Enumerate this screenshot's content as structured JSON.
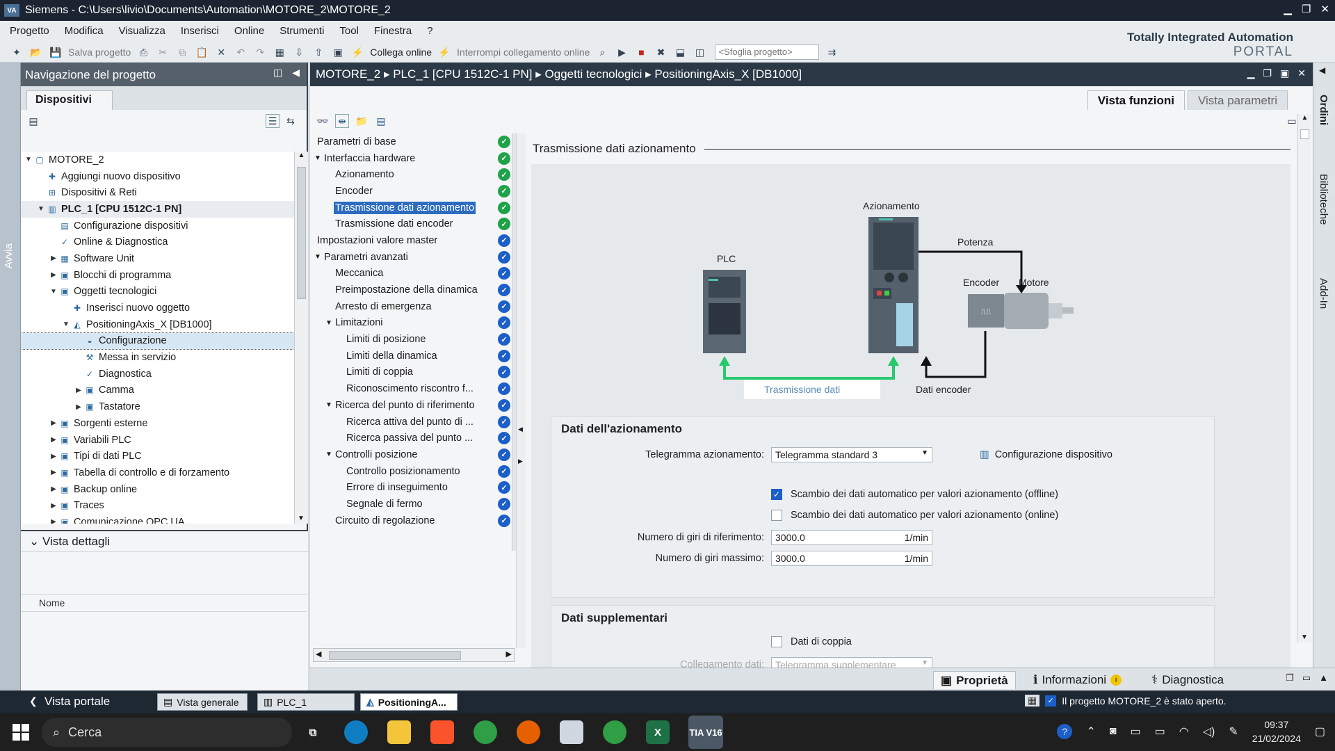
{
  "window": {
    "title": "Siemens - C:\\Users\\livio\\Documents\\Automation\\MOTORE_2\\MOTORE_2",
    "logo": "VA"
  },
  "menu": [
    "Progetto",
    "Modifica",
    "Visualizza",
    "Inserisci",
    "Online",
    "Strumenti",
    "Tool",
    "Finestra",
    "?"
  ],
  "toolbar": {
    "save": "Salva progetto",
    "connect": "Collega online",
    "disconnect": "Interrompi collegamento online",
    "browse_placeholder": "<Sfoglia progetto>"
  },
  "tia": {
    "line1": "Totally Integrated Automation",
    "line2": "PORTAL"
  },
  "side_left": "Avvia",
  "nav": {
    "title": "Navigazione del progetto",
    "tab": "Dispositivi",
    "tree": [
      {
        "label": "MOTORE_2",
        "level": 0,
        "tri": "▼",
        "icon": "project-icon"
      },
      {
        "label": "Aggiungi nuovo dispositivo",
        "level": 1,
        "tri": "",
        "icon": "add-device-icon"
      },
      {
        "label": "Dispositivi & Reti",
        "level": 1,
        "tri": "",
        "icon": "network-icon"
      },
      {
        "label": "PLC_1 [CPU 1512C-1 PN]",
        "level": 1,
        "tri": "▼",
        "icon": "plc-icon",
        "hl": true
      },
      {
        "label": "Configurazione dispositivi",
        "level": 2,
        "tri": "",
        "icon": "config-icon"
      },
      {
        "label": "Online & Diagnostica",
        "level": 2,
        "tri": "",
        "icon": "diagnostics-icon"
      },
      {
        "label": "Software Unit",
        "level": 2,
        "tri": "▶",
        "icon": "software-unit-icon"
      },
      {
        "label": "Blocchi di programma",
        "level": 2,
        "tri": "▶",
        "icon": "folder-icon"
      },
      {
        "label": "Oggetti tecnologici",
        "level": 2,
        "tri": "▼",
        "icon": "folder-icon"
      },
      {
        "label": "Inserisci nuovo oggetto",
        "level": 3,
        "tri": "",
        "icon": "add-object-icon"
      },
      {
        "label": "PositioningAxis_X [DB1000]",
        "level": 3,
        "tri": "▼",
        "icon": "axis-icon"
      },
      {
        "label": "Configurazione",
        "level": 4,
        "tri": "",
        "icon": "configuration-icon",
        "sel": true
      },
      {
        "label": "Messa in servizio",
        "level": 4,
        "tri": "",
        "icon": "commissioning-icon"
      },
      {
        "label": "Diagnostica",
        "level": 4,
        "tri": "",
        "icon": "diagnostics-icon"
      },
      {
        "label": "Camma",
        "level": 4,
        "tri": "▶",
        "icon": "folder-icon"
      },
      {
        "label": "Tastatore",
        "level": 4,
        "tri": "▶",
        "icon": "folder-icon"
      },
      {
        "label": "Sorgenti esterne",
        "level": 2,
        "tri": "▶",
        "icon": "folder-icon"
      },
      {
        "label": "Variabili PLC",
        "level": 2,
        "tri": "▶",
        "icon": "folder-icon"
      },
      {
        "label": "Tipi di dati PLC",
        "level": 2,
        "tri": "▶",
        "icon": "folder-icon"
      },
      {
        "label": "Tabella di controllo e di forzamento",
        "level": 2,
        "tri": "▶",
        "icon": "folder-icon"
      },
      {
        "label": "Backup online",
        "level": 2,
        "tri": "▶",
        "icon": "folder-icon"
      },
      {
        "label": "Traces",
        "level": 2,
        "tri": "▶",
        "icon": "folder-icon"
      },
      {
        "label": "Comunicazione OPC UA",
        "level": 2,
        "tri": "▶",
        "icon": "folder-icon"
      }
    ]
  },
  "details": {
    "title": "Vista dettagli",
    "col": "Nome"
  },
  "breadcrumb": {
    "parts": [
      "MOTORE_2",
      "PLC_1 [CPU 1512C-1 PN]",
      "Oggetti tecnologici",
      "PositioningAxis_X [DB1000]"
    ]
  },
  "viewtabs": {
    "func": "Vista funzioni",
    "param": "Vista parametri"
  },
  "config": [
    {
      "label": "Parametri di base",
      "level": 0,
      "tri": "",
      "status": "ok"
    },
    {
      "label": "Interfaccia hardware",
      "level": 0,
      "tri": "▼",
      "status": "ok"
    },
    {
      "label": "Azionamento",
      "level": 1,
      "tri": "",
      "status": "ok"
    },
    {
      "label": "Encoder",
      "level": 1,
      "tri": "",
      "status": "ok"
    },
    {
      "label": "Trasmissione dati azionamento",
      "level": 1,
      "tri": "",
      "status": "ok",
      "sel": true
    },
    {
      "label": "Trasmissione dati encoder",
      "level": 1,
      "tri": "",
      "status": "ok"
    },
    {
      "label": "Impostazioni valore master",
      "level": 0,
      "tri": "",
      "status": "bl"
    },
    {
      "label": "Parametri avanzati",
      "level": 0,
      "tri": "▼",
      "status": "bl"
    },
    {
      "label": "Meccanica",
      "level": 1,
      "tri": "",
      "status": "bl"
    },
    {
      "label": "Preimpostazione della dinamica",
      "level": 1,
      "tri": "",
      "status": "bl"
    },
    {
      "label": "Arresto di emergenza",
      "level": 1,
      "tri": "",
      "status": "bl"
    },
    {
      "label": "Limitazioni",
      "level": 1,
      "tri": "▼",
      "status": "bl"
    },
    {
      "label": "Limiti di posizione",
      "level": 2,
      "tri": "",
      "status": "bl"
    },
    {
      "label": "Limiti della dinamica",
      "level": 2,
      "tri": "",
      "status": "bl"
    },
    {
      "label": "Limiti di coppia",
      "level": 2,
      "tri": "",
      "status": "bl"
    },
    {
      "label": "Riconoscimento riscontro f...",
      "level": 2,
      "tri": "",
      "status": "bl"
    },
    {
      "label": "Ricerca del punto di riferimento",
      "level": 1,
      "tri": "▼",
      "status": "bl"
    },
    {
      "label": "Ricerca attiva del punto di ...",
      "level": 2,
      "tri": "",
      "status": "bl"
    },
    {
      "label": "Ricerca passiva del punto ...",
      "level": 2,
      "tri": "",
      "status": "bl"
    },
    {
      "label": "Controlli posizione",
      "level": 1,
      "tri": "▼",
      "status": "bl"
    },
    {
      "label": "Controllo posizionamento",
      "level": 2,
      "tri": "",
      "status": "bl"
    },
    {
      "label": "Errore di inseguimento",
      "level": 2,
      "tri": "",
      "status": "bl"
    },
    {
      "label": "Segnale di fermo",
      "level": 2,
      "tri": "",
      "status": "bl"
    },
    {
      "label": "Circuito di regolazione",
      "level": 1,
      "tri": "",
      "status": "bl"
    }
  ],
  "section": {
    "title": "Trasmissione dati azionamento"
  },
  "diagram": {
    "plc": "PLC",
    "drive": "Azionamento",
    "power": "Potenza",
    "encoder": "Encoder",
    "motor": "Motore",
    "data_tx": "Trasmissione dati",
    "enc_data": "Dati encoder"
  },
  "drive_data": {
    "title": "Dati dell'azionamento",
    "telegram_label": "Telegramma azionamento:",
    "telegram_value": "Telegramma standard 3",
    "device_config": "Configurazione dispositivo",
    "auto_offline": "Scambio dei dati automatico per valori azionamento (offline)",
    "auto_offline_checked": true,
    "auto_online": "Scambio dei dati automatico per valori azionamento (online)",
    "auto_online_checked": false,
    "ref_speed_label": "Numero di giri di riferimento:",
    "ref_speed": "3000.0",
    "max_speed_label": "Numero di giri massimo:",
    "max_speed": "3000.0",
    "unit": "1/min"
  },
  "extra": {
    "title": "Dati supplementari",
    "torque": "Dati di coppia",
    "link_label": "Collegamento dati:",
    "link_value": "Telegramma supplementare"
  },
  "rside": {
    "t1": "Ordini",
    "t2": "Biblioteche",
    "t3": "Add-In"
  },
  "bottom": {
    "prop": "Proprietà",
    "info": "Informazioni",
    "diag": "Diagnostica"
  },
  "portal": {
    "vp": "Vista portale",
    "t1": "Vista generale",
    "t2": "PLC_1",
    "t3": "PositioningA...",
    "msg": "Il progetto MOTORE_2 è stato aperto."
  },
  "taskbar": {
    "search": "Cerca",
    "time": "09:37",
    "date": "21/02/2024",
    "tia": "TIA V16"
  }
}
